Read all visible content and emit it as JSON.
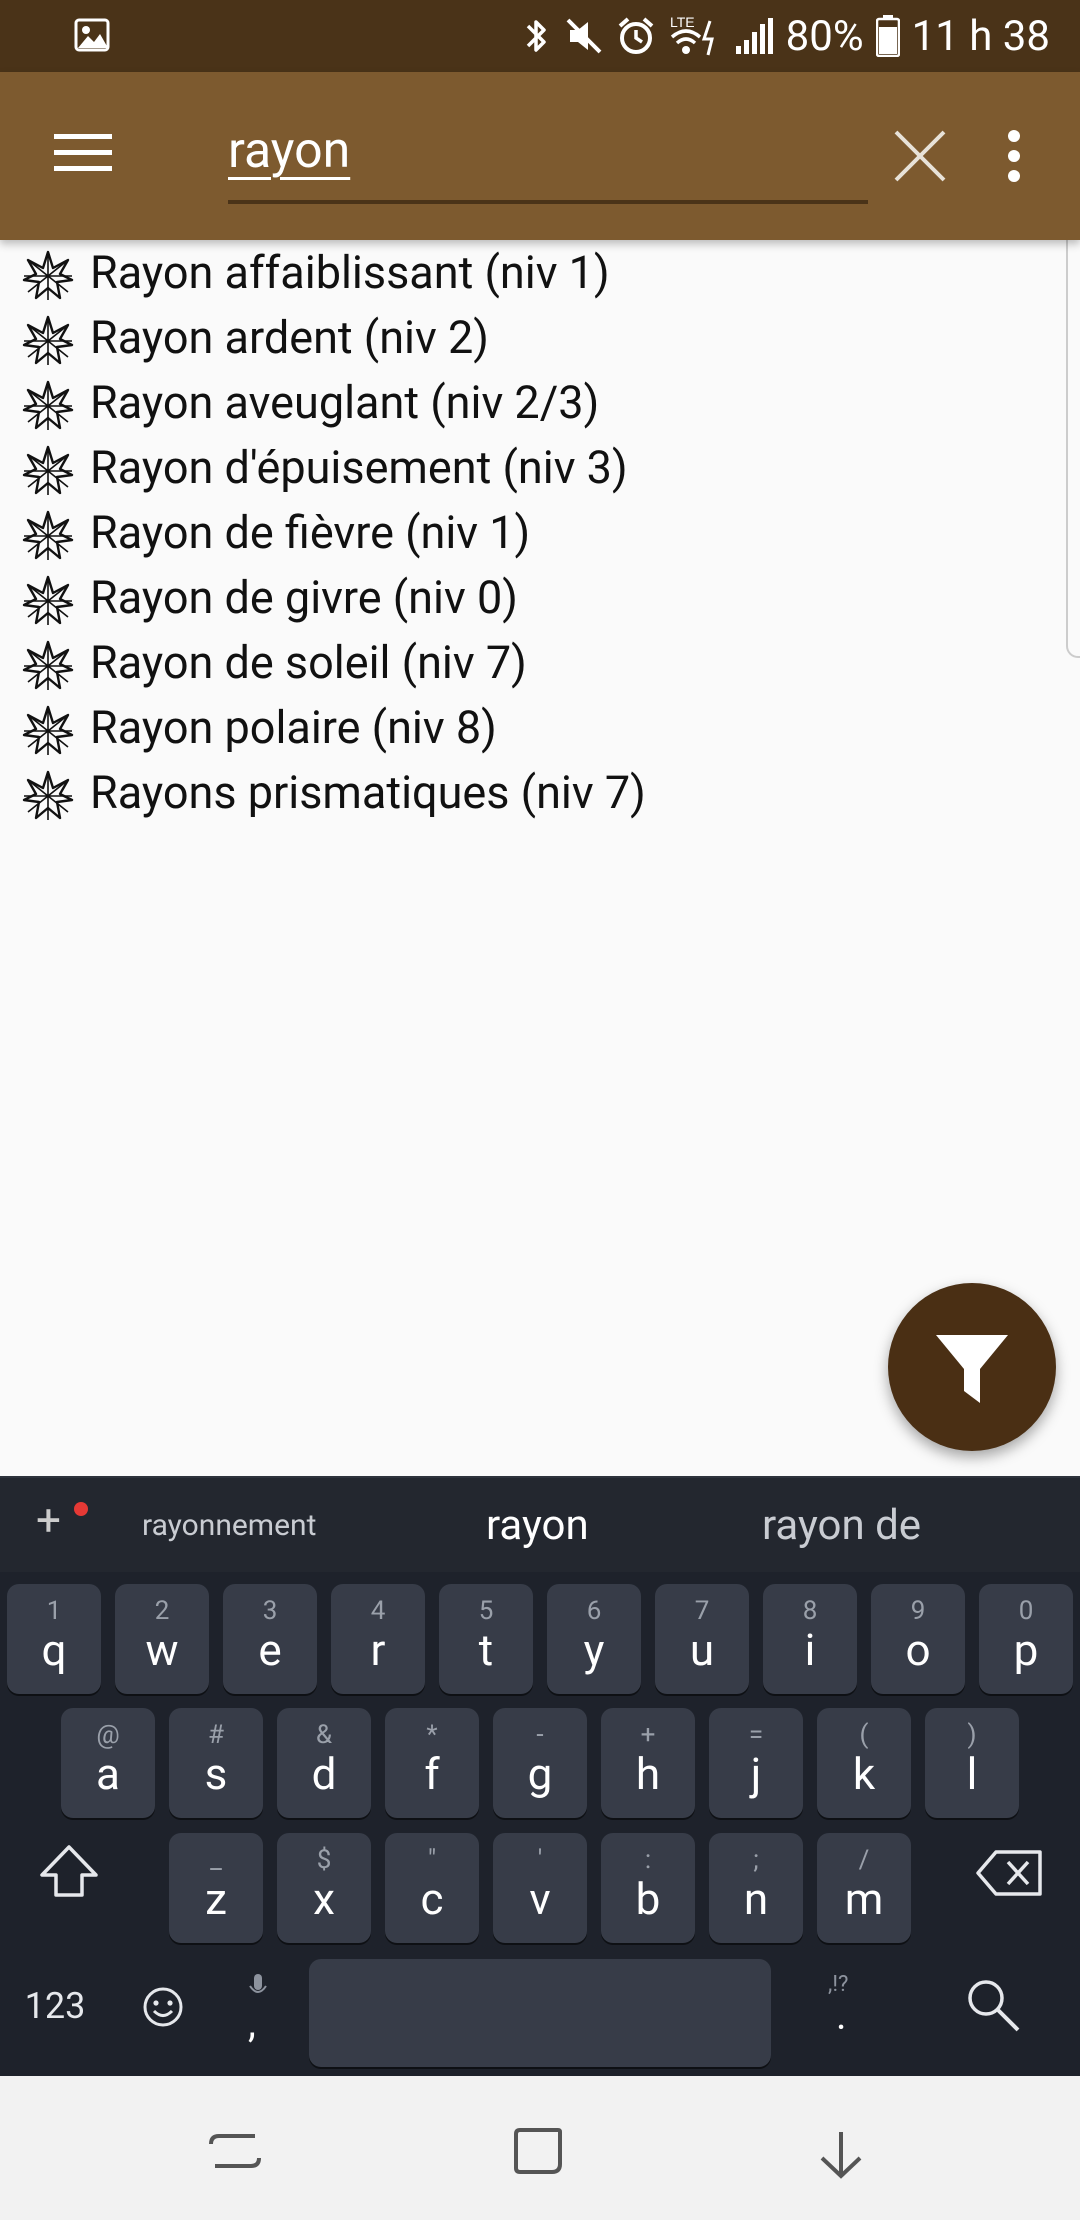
{
  "status_bar": {
    "battery_pct": "80%",
    "time": "11 h 38",
    "network_label": "LTE",
    "icons": [
      "gallery-icon",
      "bluetooth-icon",
      "mute-icon",
      "alarm-icon",
      "wifi-icon",
      "signal-icon",
      "battery-icon"
    ]
  },
  "app_bar": {
    "search_value": "rayon",
    "menu_icon": "menu-icon",
    "clear_icon": "close-icon",
    "more_icon": "more-vert-icon"
  },
  "results": [
    {
      "label": "Rayon affaiblissant (niv 1)"
    },
    {
      "label": "Rayon ardent (niv 2)"
    },
    {
      "label": "Rayon aveuglant (niv 2/3)"
    },
    {
      "label": "Rayon d'épuisement (niv 3)"
    },
    {
      "label": "Rayon de fièvre (niv 1)"
    },
    {
      "label": "Rayon de givre (niv 0)"
    },
    {
      "label": "Rayon de soleil (niv 7)"
    },
    {
      "label": "Rayon polaire (niv 8)"
    },
    {
      "label": "Rayons prismatiques (niv 7)"
    }
  ],
  "fab": {
    "icon": "filter-icon"
  },
  "keyboard": {
    "suggestions": [
      "rayonnement",
      "rayon",
      "rayon de"
    ],
    "row1": [
      {
        "hint": "1",
        "ch": "q"
      },
      {
        "hint": "2",
        "ch": "w"
      },
      {
        "hint": "3",
        "ch": "e"
      },
      {
        "hint": "4",
        "ch": "r"
      },
      {
        "hint": "5",
        "ch": "t"
      },
      {
        "hint": "6",
        "ch": "y"
      },
      {
        "hint": "7",
        "ch": "u"
      },
      {
        "hint": "8",
        "ch": "i"
      },
      {
        "hint": "9",
        "ch": "o"
      },
      {
        "hint": "0",
        "ch": "p"
      }
    ],
    "row2": [
      {
        "hint": "@",
        "ch": "a"
      },
      {
        "hint": "#",
        "ch": "s"
      },
      {
        "hint": "&",
        "ch": "d"
      },
      {
        "hint": "*",
        "ch": "f"
      },
      {
        "hint": "-",
        "ch": "g"
      },
      {
        "hint": "+",
        "ch": "h"
      },
      {
        "hint": "=",
        "ch": "j"
      },
      {
        "hint": "(",
        "ch": "k"
      },
      {
        "hint": ")",
        "ch": "l"
      }
    ],
    "row3": [
      {
        "hint": "_",
        "ch": "z"
      },
      {
        "hint": "$",
        "ch": "x"
      },
      {
        "hint": "\"",
        "ch": "c"
      },
      {
        "hint": "'",
        "ch": "v"
      },
      {
        "hint": ":",
        "ch": "b"
      },
      {
        "hint": ";",
        "ch": "n"
      },
      {
        "hint": "/",
        "ch": "m"
      }
    ],
    "num_label": "123",
    "comma": ",",
    "period": ".",
    "period_hint": ",!?"
  },
  "colors": {
    "status_bar": "#4a3318",
    "app_bar": "#7d5a2f",
    "fab": "#4a2f14",
    "keyboard_bg": "#1e222b",
    "key_bg": "#373c48"
  }
}
